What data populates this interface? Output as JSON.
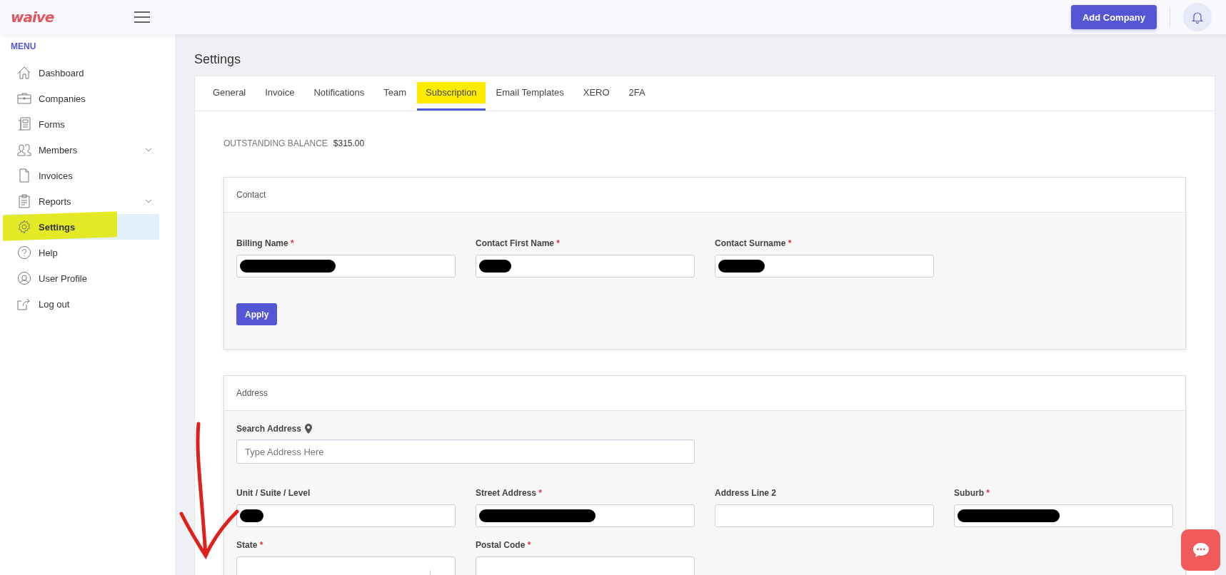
{
  "header": {
    "logo": "waive",
    "add_button": "Add Company"
  },
  "sidebar": {
    "heading": "MENU",
    "items": [
      {
        "label": "Dashboard",
        "expandable": false,
        "selected": false,
        "highlighted": false
      },
      {
        "label": "Companies",
        "expandable": false,
        "selected": false,
        "highlighted": false
      },
      {
        "label": "Forms",
        "expandable": false,
        "selected": false,
        "highlighted": false
      },
      {
        "label": "Members",
        "expandable": true,
        "selected": false,
        "highlighted": false
      },
      {
        "label": "Invoices",
        "expandable": false,
        "selected": false,
        "highlighted": false
      },
      {
        "label": "Reports",
        "expandable": true,
        "selected": false,
        "highlighted": false
      },
      {
        "label": "Settings",
        "expandable": false,
        "selected": true,
        "highlighted": true
      },
      {
        "label": "Help",
        "expandable": false,
        "selected": false,
        "highlighted": false
      },
      {
        "label": "User Profile",
        "expandable": false,
        "selected": false,
        "highlighted": false
      },
      {
        "label": "Log out",
        "expandable": false,
        "selected": false,
        "highlighted": false
      }
    ]
  },
  "page_title": "Settings",
  "tabs": [
    {
      "label": "General",
      "selected": false,
      "highlighted": false
    },
    {
      "label": "Invoice",
      "selected": false,
      "highlighted": false
    },
    {
      "label": "Notifications",
      "selected": false,
      "highlighted": false
    },
    {
      "label": "Team",
      "selected": false,
      "highlighted": false
    },
    {
      "label": "Subscription",
      "selected": true,
      "highlighted": true
    },
    {
      "label": "Email Templates",
      "selected": false,
      "highlighted": false
    },
    {
      "label": "XERO",
      "selected": false,
      "highlighted": false
    },
    {
      "label": "2FA",
      "selected": false,
      "highlighted": false
    }
  ],
  "balance": {
    "label": "OUTSTANDING BALANCE",
    "value": "$315.00"
  },
  "contact": {
    "title": "Contact",
    "fields": [
      {
        "label": "Billing Name",
        "required_mark": "*",
        "kind": "text",
        "redacted": true
      },
      {
        "label": "Contact First Name",
        "required_mark": "*",
        "kind": "text",
        "redacted": true
      },
      {
        "label": "Contact Surname",
        "required_mark": "*",
        "kind": "text",
        "redacted": true
      }
    ],
    "button": "Apply"
  },
  "address": {
    "title": "Address",
    "search": {
      "label": "Search Address",
      "placeholder": "Type Address Here"
    },
    "fields": [
      {
        "label": "Unit / Suite / Level",
        "kind": "text",
        "redacted": true
      },
      {
        "label": "Street Address",
        "required_mark": "*",
        "kind": "text",
        "redacted": true
      },
      {
        "label": "Address Line 2",
        "kind": "text",
        "redacted": false
      },
      {
        "label": "Suburb",
        "required_mark": "*",
        "kind": "text",
        "redacted": true
      },
      {
        "label": "State",
        "required_mark": "*",
        "kind": "select",
        "redacted": false
      },
      {
        "label": "Postal Code",
        "required_mark": "*",
        "kind": "text",
        "redacted": false
      }
    ]
  }
}
